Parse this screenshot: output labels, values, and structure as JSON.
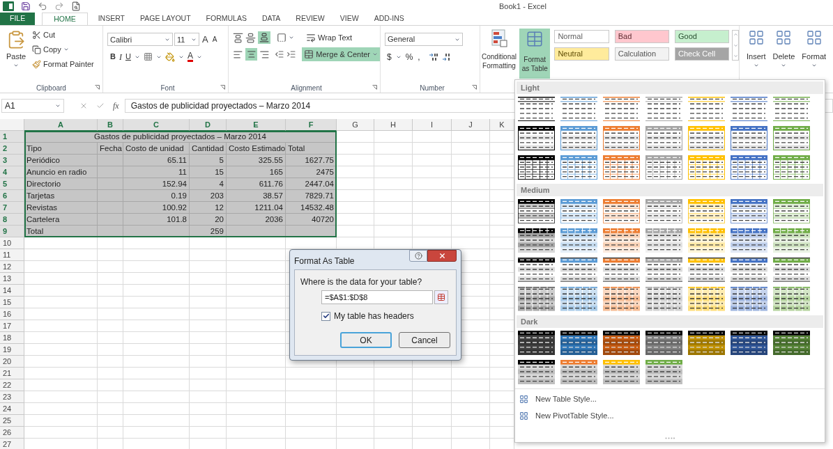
{
  "title_bar": {
    "title": "Book1 - Excel"
  },
  "tabs": [
    {
      "label": "FILE",
      "kind": "file",
      "selected": false
    },
    {
      "label": "HOME",
      "kind": "tab",
      "selected": true
    },
    {
      "label": "INSERT",
      "kind": "tab",
      "selected": false
    },
    {
      "label": "PAGE LAYOUT",
      "kind": "tab",
      "selected": false
    },
    {
      "label": "FORMULAS",
      "kind": "tab",
      "selected": false
    },
    {
      "label": "DATA",
      "kind": "tab",
      "selected": false
    },
    {
      "label": "REVIEW",
      "kind": "tab",
      "selected": false
    },
    {
      "label": "VIEW",
      "kind": "tab",
      "selected": false
    },
    {
      "label": "ADD-INS",
      "kind": "tab",
      "selected": false
    }
  ],
  "ribbon": {
    "clipboard": {
      "paste": "Paste",
      "cut": "Cut",
      "copy": "Copy",
      "format_painter": "Format Painter",
      "label": "Clipboard"
    },
    "font": {
      "name": "Calibri",
      "size": "11",
      "grow": "A",
      "shrink": "A",
      "styles": [
        "B",
        "I",
        "U"
      ],
      "color_letter": "A",
      "label": "Font"
    },
    "alignment": {
      "wrap_text": "Wrap Text",
      "merge_center": {
        "label": "Merge & Center",
        "selected": true
      },
      "label": "Alignment"
    },
    "number": {
      "format": "General",
      "symbols": [
        "$",
        "%",
        ","
      ],
      "label": "Number"
    },
    "styles": {
      "conditional": "Conditional Formatting",
      "format_table": {
        "label": "Format as Table",
        "open": true
      },
      "cell_styles": [
        {
          "label": "Normal",
          "color": "#ffffff"
        },
        {
          "label": "Bad",
          "color": "#ffc7ce"
        },
        {
          "label": "Good",
          "color": "#c6efce"
        },
        {
          "label": "Neutral",
          "color": "#ffeb9c"
        },
        {
          "label": "Calculation",
          "color": "#f2f2f2"
        },
        {
          "label": "Check Cell",
          "color": "#a5a5a5"
        }
      ]
    },
    "cells": {
      "buttons": [
        "Insert",
        "Delete",
        "Format"
      ]
    }
  },
  "formula_bar": {
    "name_box": "A1",
    "function_label": "fx",
    "formula": "Gastos de publicidad proyectados – Marzo 2014"
  },
  "sheet": {
    "columns": [
      {
        "label": "A",
        "selected": true
      },
      {
        "label": "B",
        "selected": true
      },
      {
        "label": "C",
        "selected": true
      },
      {
        "label": "D",
        "selected": true
      },
      {
        "label": "E",
        "selected": true
      },
      {
        "label": "F",
        "selected": true
      },
      {
        "label": "G",
        "selected": false
      },
      {
        "label": "H",
        "selected": false
      },
      {
        "label": "I",
        "selected": false
      },
      {
        "label": "J",
        "selected": false
      },
      {
        "label": "K",
        "selected": false
      }
    ],
    "rows": [
      {
        "number": "1",
        "kind": "title",
        "selected": true,
        "title": "Gastos de publicidad proyectados – Marzo 2014"
      },
      {
        "number": "2",
        "kind": "header",
        "selected": true,
        "cells": [
          "Tipo",
          "Fecha",
          "Costo de unidad",
          "Cantidad",
          "Costo Estimado",
          "Total"
        ]
      },
      {
        "number": "3",
        "kind": "data",
        "selected": true,
        "cells": [
          "Periódico",
          null,
          "65.11",
          "5",
          "325.55",
          "1627.75"
        ]
      },
      {
        "number": "4",
        "kind": "data",
        "selected": true,
        "cells": [
          "Anuncio en radio",
          null,
          "11",
          "15",
          "165",
          "2475"
        ]
      },
      {
        "number": "5",
        "kind": "data",
        "selected": true,
        "cells": [
          "Directorio",
          null,
          "152.94",
          "4",
          "611.76",
          "2447.04"
        ]
      },
      {
        "number": "6",
        "kind": "data",
        "selected": true,
        "cells": [
          "Tarjetas",
          null,
          "0.19",
          "203",
          "38.57",
          "7829.71"
        ]
      },
      {
        "number": "7",
        "kind": "data",
        "selected": true,
        "cells": [
          "Revistas",
          null,
          "100.92",
          "12",
          "1211.04",
          "14532.48"
        ]
      },
      {
        "number": "8",
        "kind": "data",
        "selected": true,
        "cells": [
          "Cartelera",
          null,
          "101.8",
          "20",
          "2036",
          "40720"
        ]
      },
      {
        "number": "9",
        "kind": "data",
        "selected": true,
        "cells": [
          "Total",
          null,
          null,
          "259",
          null,
          null
        ]
      },
      {
        "number": "10",
        "kind": "empty",
        "selected": false
      },
      {
        "number": "11",
        "kind": "empty",
        "selected": false
      },
      {
        "number": "12",
        "kind": "empty",
        "selected": false
      },
      {
        "number": "13",
        "kind": "empty",
        "selected": false
      },
      {
        "number": "14",
        "kind": "empty",
        "selected": false
      },
      {
        "number": "15",
        "kind": "empty",
        "selected": false
      },
      {
        "number": "16",
        "kind": "empty",
        "selected": false
      },
      {
        "number": "17",
        "kind": "empty",
        "selected": false
      },
      {
        "number": "18",
        "kind": "empty",
        "selected": false
      },
      {
        "number": "19",
        "kind": "empty",
        "selected": false
      },
      {
        "number": "20",
        "kind": "empty",
        "selected": false
      },
      {
        "number": "21",
        "kind": "empty",
        "selected": false
      },
      {
        "number": "22",
        "kind": "empty",
        "selected": false
      },
      {
        "number": "23",
        "kind": "empty",
        "selected": false
      },
      {
        "number": "24",
        "kind": "empty",
        "selected": false
      },
      {
        "number": "25",
        "kind": "empty",
        "selected": false
      },
      {
        "number": "26",
        "kind": "empty",
        "selected": false
      },
      {
        "number": "27",
        "kind": "empty",
        "selected": false
      }
    ]
  },
  "dialog": {
    "title": "Format As Table",
    "prompt": "Where is the data for your table?",
    "range": "=$A$1:$D$8",
    "has_headers": {
      "label": "My table has headers",
      "checked": true
    },
    "buttons": [
      {
        "label": "OK",
        "default": true
      },
      {
        "label": "Cancel",
        "default": false
      }
    ]
  },
  "gallery": {
    "sections": [
      {
        "label": "Light",
        "rows": [
          {
            "kind": "plain",
            "swatches": [
              {
                "color": "#000000"
              },
              {
                "color": "#5b9bd5"
              },
              {
                "color": "#ed7d31"
              },
              {
                "color": "#a5a5a5"
              },
              {
                "color": "#ffc000"
              },
              {
                "color": "#4472c4"
              },
              {
                "color": "#70ad47"
              }
            ]
          },
          {
            "kind": "header",
            "swatches": [
              {
                "color": "#000000"
              },
              {
                "color": "#5b9bd5"
              },
              {
                "color": "#ed7d31"
              },
              {
                "color": "#a5a5a5"
              },
              {
                "color": "#ffc000"
              },
              {
                "color": "#4472c4"
              },
              {
                "color": "#70ad47"
              }
            ]
          },
          {
            "kind": "grid",
            "swatches": [
              {
                "color": "#000000"
              },
              {
                "color": "#5b9bd5"
              },
              {
                "color": "#ed7d31"
              },
              {
                "color": "#a5a5a5"
              },
              {
                "color": "#ffc000"
              },
              {
                "color": "#4472c4"
              },
              {
                "color": "#70ad47"
              }
            ]
          }
        ]
      },
      {
        "label": "Medium",
        "rows": [
          {
            "kind": "banded",
            "swatches": [
              {
                "color": "#000000"
              },
              {
                "color": "#5b9bd5"
              },
              {
                "color": "#ed7d31"
              },
              {
                "color": "#a5a5a5"
              },
              {
                "color": "#ffc000"
              },
              {
                "color": "#4472c4"
              },
              {
                "color": "#70ad47"
              }
            ]
          },
          {
            "kind": "columns",
            "swatches": [
              {
                "color": "#000000"
              },
              {
                "color": "#5b9bd5"
              },
              {
                "color": "#ed7d31"
              },
              {
                "color": "#a5a5a5"
              },
              {
                "color": "#ffc000"
              },
              {
                "color": "#4472c4"
              },
              {
                "color": "#70ad47"
              }
            ]
          },
          {
            "kind": "lined",
            "swatches": [
              {
                "color": "#000000"
              },
              {
                "color": "#5b9bd5"
              },
              {
                "color": "#ed7d31"
              },
              {
                "color": "#a5a5a5"
              },
              {
                "color": "#ffc000"
              },
              {
                "color": "#4472c4"
              },
              {
                "color": "#70ad47"
              }
            ]
          },
          {
            "kind": "full",
            "swatches": [
              {
                "color": "#595959"
              },
              {
                "color": "#5b9bd5"
              },
              {
                "color": "#ed7d31"
              },
              {
                "color": "#a5a5a5"
              },
              {
                "color": "#ffc000"
              },
              {
                "color": "#4472c4"
              },
              {
                "color": "#70ad47"
              }
            ]
          }
        ]
      },
      {
        "label": "Dark",
        "rows": [
          {
            "kind": "dark",
            "swatches": [
              {
                "color": "#404040"
              },
              {
                "color": "#2e75b6"
              },
              {
                "color": "#c55a11"
              },
              {
                "color": "#7f7f7f"
              },
              {
                "color": "#bf9000"
              },
              {
                "color": "#2f5597"
              },
              {
                "color": "#548235"
              }
            ]
          },
          {
            "kind": "dark_alt",
            "swatches": [
              {
                "color": "#000000"
              },
              {
                "color": "#ed7d31"
              },
              {
                "color": "#ffc000"
              },
              {
                "color": "#70ad47"
              }
            ]
          }
        ]
      }
    ],
    "menu": [
      {
        "label": "New Table Style..."
      },
      {
        "label": "New PivotTable Style..."
      }
    ]
  }
}
